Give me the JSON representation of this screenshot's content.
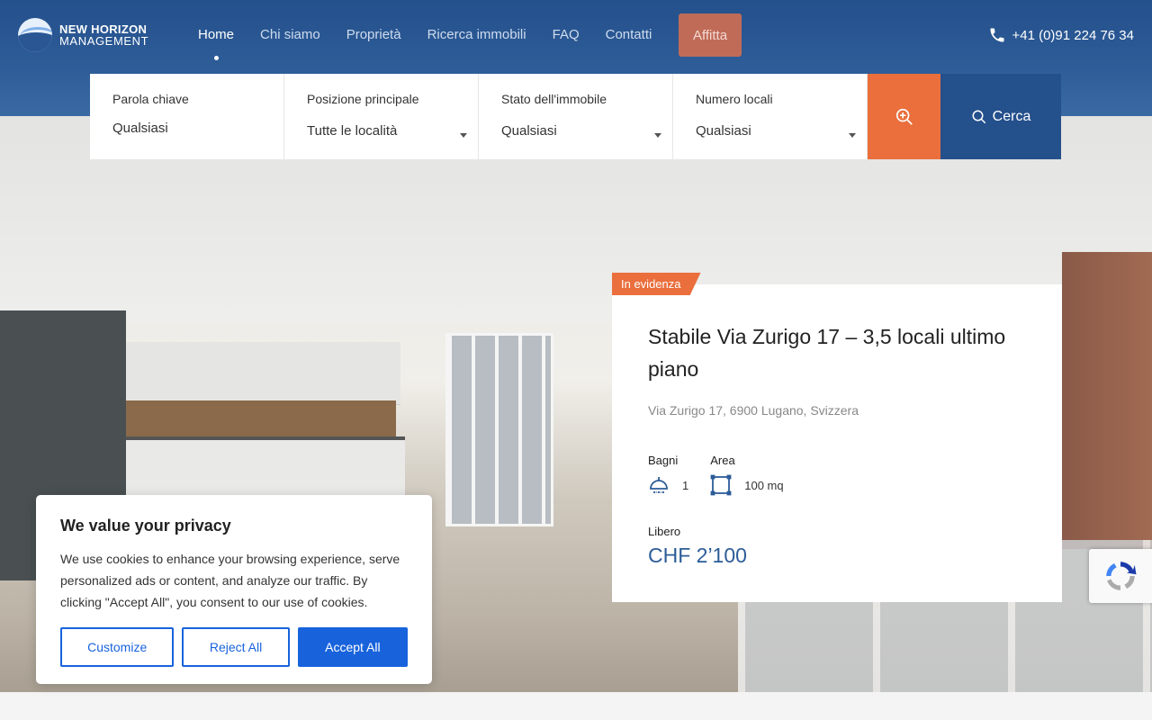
{
  "brand": {
    "line1": "NEW HORIZON",
    "line2": "MANAGEMENT"
  },
  "nav": {
    "items": [
      {
        "label": "Home",
        "active": true
      },
      {
        "label": "Chi siamo"
      },
      {
        "label": "Proprietà"
      },
      {
        "label": "Ricerca immobili"
      },
      {
        "label": "FAQ"
      },
      {
        "label": "Contatti"
      }
    ],
    "cta": "Affitta"
  },
  "phone": "+41 (0)91 224 76 34",
  "search": {
    "keyword": {
      "label": "Parola chiave",
      "value": "Qualsiasi"
    },
    "location": {
      "label": "Posizione principale",
      "value": "Tutte le località"
    },
    "status": {
      "label": "Stato dell'immobile",
      "value": "Qualsiasi"
    },
    "rooms": {
      "label": "Numero locali",
      "value": "Qualsiasi"
    },
    "submit": "Cerca"
  },
  "featured": {
    "badge": "In evidenza",
    "title": "Stabile Via Zurigo 17 – 3,5 locali ultimo piano",
    "address": "Via Zurigo 17, 6900 Lugano, Svizzera",
    "baths_label": "Bagni",
    "baths": "1",
    "area_label": "Area",
    "area": "100 mq",
    "status": "Libero",
    "price": "CHF 2’100"
  },
  "cookie": {
    "title": "We value your privacy",
    "text": "We use cookies to enhance your browsing experience, serve personalized ads or content, and analyze our traffic. By clicking \"Accept All\", you consent to our use of cookies.",
    "customize": "Customize",
    "reject": "Reject All",
    "accept": "Accept All"
  },
  "colors": {
    "header": "#24508c",
    "accent": "#ea6f3d",
    "cookie_blue": "#1863dc",
    "price": "#2c5c98"
  }
}
